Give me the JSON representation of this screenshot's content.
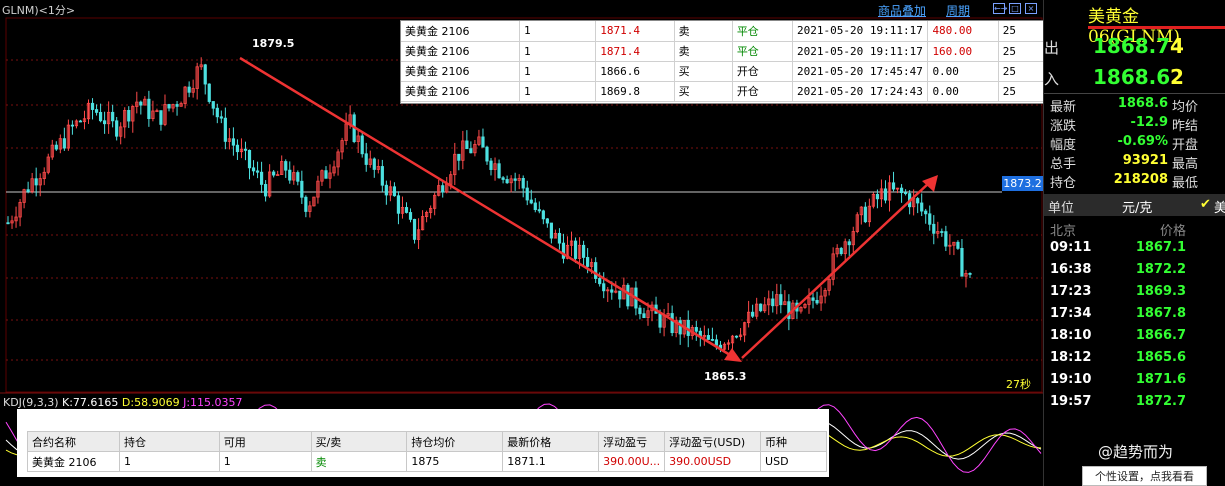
{
  "header": {
    "instrument": "GLNM)<1分>",
    "links": [
      "商品叠加",
      "周期"
    ],
    "window_buttons": [
      "←→",
      "□",
      "×"
    ]
  },
  "annotations": {
    "high_label": "1879.5",
    "low_label": "1865.3",
    "current_price": "1873.2",
    "countdown": "27秒"
  },
  "kdj": {
    "title": "KDJ(9,3,3)",
    "k": "K:77.6165",
    "d": "D:58.9069",
    "j": "J:115.0357",
    "colors": {
      "k": "#ffffff",
      "d": "#ffff33",
      "j": "#ff44ff"
    }
  },
  "trades": [
    {
      "name": "美黄金 2106",
      "qty": "1",
      "price": "1871.4",
      "side": "卖",
      "action": "平仓",
      "time": "2021-05-20 19:11:17",
      "pnl": "480.00",
      "lev": "25",
      "highlight": true
    },
    {
      "name": "美黄金 2106",
      "qty": "1",
      "price": "1871.4",
      "side": "卖",
      "action": "平仓",
      "time": "2021-05-20 19:11:17",
      "pnl": "160.00",
      "lev": "25",
      "highlight": true
    },
    {
      "name": "美黄金 2106",
      "qty": "1",
      "price": "1866.6",
      "side": "买",
      "action": "开仓",
      "time": "2021-05-20 17:45:47",
      "pnl": "0.00",
      "lev": "25",
      "highlight": false
    },
    {
      "name": "美黄金 2106",
      "qty": "1",
      "price": "1869.8",
      "side": "买",
      "action": "开仓",
      "time": "2021-05-20 17:24:43",
      "pnl": "0.00",
      "lev": "25",
      "highlight": false
    }
  ],
  "position": {
    "headers": [
      "合约名称",
      "持仓",
      "可用",
      "买/卖",
      "持仓均价",
      "最新价格",
      "浮动盈亏",
      "浮动盈亏(USD)",
      "币种"
    ],
    "row": [
      "美黄金 2106",
      "1",
      "1",
      "卖",
      "1875",
      "1871.1",
      "390.00U...",
      "390.00USD",
      "USD"
    ]
  },
  "sidebar": {
    "title": "美黄金06(GLNM)",
    "sell_label": "出",
    "sell_price": "1868.7",
    "sell_vol": "4",
    "buy_label": "入",
    "buy_price": "1868.6",
    "buy_vol": "2",
    "stats": [
      {
        "label": "最新",
        "value": "1868.6",
        "label2": "均价",
        "color": "#33ff33"
      },
      {
        "label": "涨跌",
        "value": "-12.9",
        "label2": "昨结",
        "color": "#33ff33"
      },
      {
        "label": "幅度",
        "value": "-0.69%",
        "label2": "开盘",
        "color": "#33ff33"
      },
      {
        "label": "总手",
        "value": "93921",
        "label2": "最高",
        "color": "#ffff33"
      },
      {
        "label": "持仓",
        "value": "218208",
        "label2": "最低",
        "color": "#ffff33"
      }
    ],
    "unit_label": "单位",
    "unit_value": "元/克",
    "unit_extra": "美",
    "ticks_header": {
      "left": "北京",
      "right": "价格"
    },
    "ticks": [
      {
        "time": "09:11",
        "price": "1867.1"
      },
      {
        "time": "16:38",
        "price": "1872.2"
      },
      {
        "time": "17:23",
        "price": "1869.3"
      },
      {
        "time": "17:34",
        "price": "1867.8"
      },
      {
        "time": "18:10",
        "price": "1866.7"
      },
      {
        "time": "18:12",
        "price": "1865.6"
      },
      {
        "time": "19:10",
        "price": "1871.6"
      },
      {
        "time": "19:57",
        "price": "1872.7"
      }
    ]
  },
  "watermark": "@趋势而为",
  "tip": "个性设置，点我看看",
  "chart_data": {
    "type": "line",
    "series": [
      {
        "values": [
          1871.6,
          1873.6,
          1874.9,
          1876.4,
          1877.4,
          1876.4,
          1877.8,
          1876.9,
          1877.9,
          1879.5,
          1876.4,
          1874.9,
          1873.4,
          1874.4,
          1872.5,
          1874.4,
          1876.6,
          1874.4,
          1873.0,
          1871.0,
          1873.0,
          1875.1,
          1875.5,
          1874.3,
          1873.6,
          1871.6,
          1870.3,
          1869.9,
          1868.5,
          1867.9,
          1867.0,
          1866.4,
          1866.0,
          1865.3,
          1866.1,
          1867.0,
          1867.7,
          1866.7,
          1868.2,
          1870.5,
          1872.0,
          1873.2,
          1873.0,
          1871.9,
          1870.6,
          1868.7
        ]
      }
    ],
    "ylim": [
      1863,
      1882
    ]
  }
}
